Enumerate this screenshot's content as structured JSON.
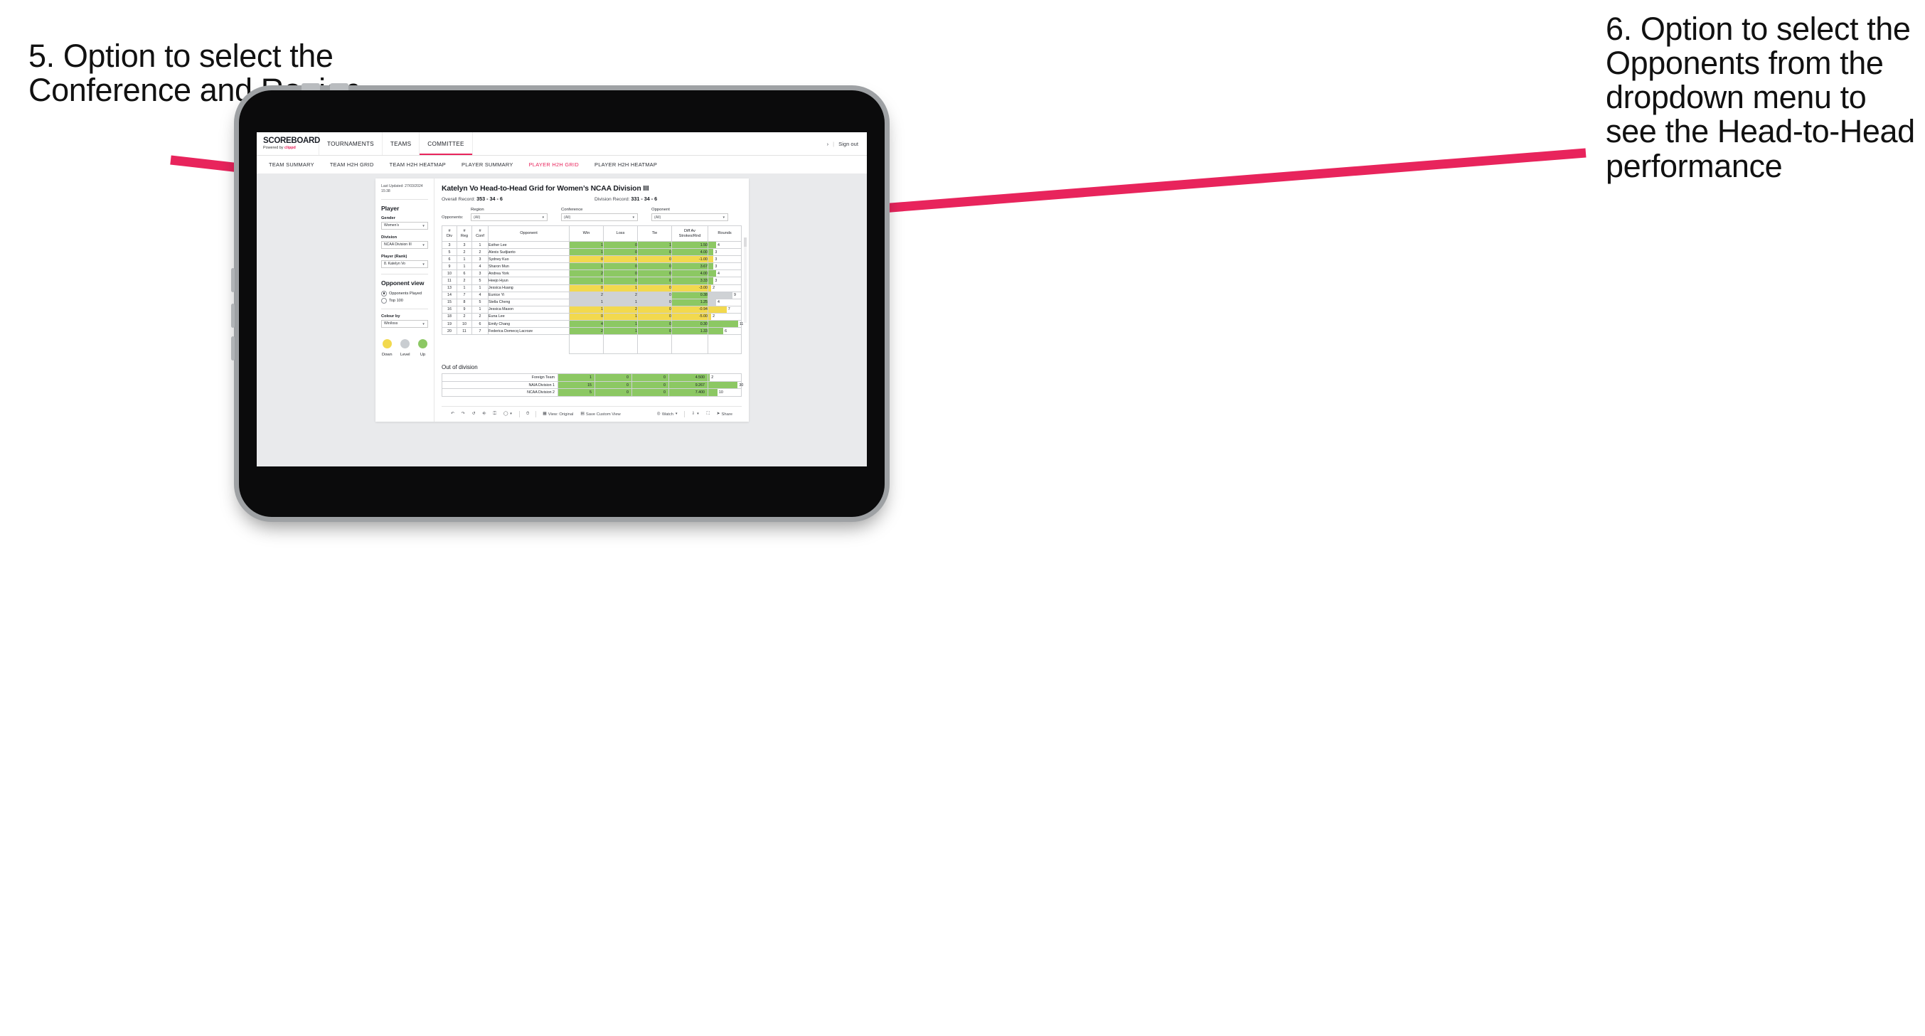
{
  "annotations": {
    "left": "5. Option to select the Conference and Region",
    "right": "6. Option to select the Opponents from the dropdown menu to see the Head-to-Head performance",
    "arrow_color": "#E8245C"
  },
  "topnav": {
    "brand_name": "SCOREBOARD",
    "brand_sub_prefix": "Powered by ",
    "brand_sub_accent": "clippd",
    "tabs": [
      {
        "label": "TOURNAMENTS",
        "active": false
      },
      {
        "label": "TEAMS",
        "active": false
      },
      {
        "label": "COMMITTEE",
        "active": true
      }
    ],
    "chevron": "›",
    "separator": "|",
    "signout": "Sign out"
  },
  "subnav": {
    "tabs": [
      {
        "label": "TEAM SUMMARY",
        "active": false
      },
      {
        "label": "TEAM H2H GRID",
        "active": false
      },
      {
        "label": "TEAM H2H HEATMAP",
        "active": false
      },
      {
        "label": "PLAYER SUMMARY",
        "active": false
      },
      {
        "label": "PLAYER H2H GRID",
        "active": true
      },
      {
        "label": "PLAYER H2H HEATMAP",
        "active": false
      }
    ]
  },
  "sidebar": {
    "last_updated": "Last Updated: 27/03/2024 15:38",
    "section_player": "Player",
    "gender_label": "Gender",
    "gender_value": "Women’s",
    "division_label": "Division",
    "division_value": "NCAA Division III",
    "player_label": "Player (Rank)",
    "player_value": "8. Katelyn Vo",
    "opponent_view_title": "Opponent view",
    "opponent_view_options": [
      {
        "label": "Opponents Played",
        "selected": true
      },
      {
        "label": "Top 100",
        "selected": false
      }
    ],
    "colour_by_label": "Colour by",
    "colour_by_value": "Win/loss",
    "legend": [
      {
        "label": "Down",
        "color": "#F2D94E"
      },
      {
        "label": "Level",
        "color": "#C9CDD1"
      },
      {
        "label": "Up",
        "color": "#8CC863"
      }
    ]
  },
  "content": {
    "title": "Katelyn Vo Head-to-Head Grid for Women’s NCAA Division III",
    "overall_record_label": "Overall Record:",
    "overall_record_value": "353 - 34 - 6",
    "division_record_label": "Division Record:",
    "division_record_value": "331 - 34 - 6",
    "opponents_label": "Opponents:",
    "filters": [
      {
        "label": "Region",
        "value": "(All)"
      },
      {
        "label": "Conference",
        "value": "(All)"
      },
      {
        "label": "Opponent",
        "value": "(All)"
      }
    ]
  },
  "chart_data": {
    "type": "table",
    "title": "Katelyn Vo Head-to-Head Grid for Women’s NCAA Division III",
    "columns": [
      "# Div",
      "# Reg",
      "# Conf",
      "Opponent",
      "Win",
      "Loss",
      "Tie",
      "Diff Av Strokes/Rnd",
      "Rounds"
    ],
    "column_header_lines": [
      [
        "#",
        "Div"
      ],
      [
        "#",
        "Reg"
      ],
      [
        "#",
        "Conf"
      ],
      [
        "Opponent"
      ],
      [
        "Win"
      ],
      [
        "Loss"
      ],
      [
        "Tie"
      ],
      [
        "Diff Av",
        "Strokes/Rnd"
      ],
      [
        "Rounds"
      ]
    ],
    "rows": [
      {
        "div": "3",
        "reg": "3",
        "conf": "1",
        "opponent": "Esther Lee",
        "win": "1",
        "loss": "0",
        "tie": "1",
        "diff": "1.50",
        "rounds": "4",
        "rounds_pct": 24,
        "status": "up"
      },
      {
        "div": "5",
        "reg": "2",
        "conf": "2",
        "opponent": "Alexis Sudjianto",
        "win": "1",
        "loss": "0",
        "tie": "0",
        "diff": "4.00",
        "rounds": "3",
        "rounds_pct": 16,
        "status": "up"
      },
      {
        "div": "6",
        "reg": "1",
        "conf": "3",
        "opponent": "Sydney Kuo",
        "win": "0",
        "loss": "1",
        "tie": "0",
        "diff": "-1.00",
        "rounds": "3",
        "rounds_pct": 16,
        "status": "down"
      },
      {
        "div": "9",
        "reg": "1",
        "conf": "4",
        "opponent": "Sharon Mun",
        "win": "1",
        "loss": "0",
        "tie": "0",
        "diff": "3.67",
        "rounds": "3",
        "rounds_pct": 16,
        "status": "up"
      },
      {
        "div": "10",
        "reg": "6",
        "conf": "3",
        "opponent": "Andrea York",
        "win": "2",
        "loss": "0",
        "tie": "0",
        "diff": "4.00",
        "rounds": "4",
        "rounds_pct": 24,
        "status": "up"
      },
      {
        "div": "11",
        "reg": "2",
        "conf": "5",
        "opponent": "Heejo Hyun",
        "win": "1",
        "loss": "0",
        "tie": "0",
        "diff": "3.33",
        "rounds": "3",
        "rounds_pct": 16,
        "status": "up"
      },
      {
        "div": "13",
        "reg": "1",
        "conf": "1",
        "opponent": "Jessica Huang",
        "win": "0",
        "loss": "1",
        "tie": "0",
        "diff": "-3.00",
        "rounds": "2",
        "rounds_pct": 9,
        "status": "down"
      },
      {
        "div": "14",
        "reg": "7",
        "conf": "4",
        "opponent": "Eunice Yi",
        "win": "2",
        "loss": "2",
        "tie": "0",
        "diff": "0.38",
        "rounds": "9",
        "rounds_pct": 74,
        "status": "level",
        "diff_status": "up"
      },
      {
        "div": "15",
        "reg": "8",
        "conf": "5",
        "opponent": "Stella Cheng",
        "win": "1",
        "loss": "1",
        "tie": "0",
        "diff": "1.25",
        "rounds": "4",
        "rounds_pct": 24,
        "status": "level",
        "diff_status": "up"
      },
      {
        "div": "16",
        "reg": "9",
        "conf": "1",
        "opponent": "Jessica Mason",
        "win": "1",
        "loss": "2",
        "tie": "0",
        "diff": "-0.94",
        "rounds": "7",
        "rounds_pct": 56,
        "status": "down"
      },
      {
        "div": "18",
        "reg": "2",
        "conf": "2",
        "opponent": "Euna Lee",
        "win": "0",
        "loss": "1",
        "tie": "0",
        "diff": "-5.00",
        "rounds": "2",
        "rounds_pct": 9,
        "status": "down"
      },
      {
        "div": "19",
        "reg": "10",
        "conf": "6",
        "opponent": "Emily Chang",
        "win": "4",
        "loss": "1",
        "tie": "0",
        "diff": "0.30",
        "rounds": "11",
        "rounds_pct": 91,
        "status": "up"
      },
      {
        "div": "20",
        "reg": "11",
        "conf": "7",
        "opponent": "Federica Domecq Lacroze",
        "win": "2",
        "loss": "1",
        "tie": "0",
        "diff": "1.33",
        "rounds": "6",
        "rounds_pct": 46,
        "status": "up"
      }
    ],
    "out_of_division_title": "Out of division",
    "out_of_division_rows": [
      {
        "label": "Foreign Team",
        "win": "1",
        "loss": "0",
        "tie": "0",
        "diff": "4.500",
        "rounds": "2",
        "rounds_pct": 5,
        "status": "up"
      },
      {
        "label": "NAIA Division 1",
        "win": "15",
        "loss": "0",
        "tie": "0",
        "diff": "9.267",
        "rounds": "30",
        "rounds_pct": 90,
        "status": "up"
      },
      {
        "label": "NCAA Division 2",
        "win": "5",
        "loss": "0",
        "tie": "0",
        "diff": "7.400",
        "rounds": "10",
        "rounds_pct": 28,
        "status": "up"
      }
    ],
    "colors": {
      "up": "#8CC863",
      "down": "#F2D94E",
      "level": "#CFD2D5",
      "neutral": "#FFFFFF"
    }
  },
  "toolbar": {
    "items": [
      {
        "icon": "undo-icon",
        "label": ""
      },
      {
        "icon": "redo-icon",
        "label": ""
      },
      {
        "icon": "revert-icon",
        "label": ""
      },
      {
        "icon": "refresh-data-icon",
        "label": ""
      },
      {
        "icon": "pause-updates-icon",
        "label": ""
      },
      {
        "icon": "highlight-icon",
        "label": ""
      },
      {
        "icon": "history-icon",
        "label": ""
      },
      {
        "icon": "view-icon",
        "label": "View: Original"
      },
      {
        "icon": "save-view-icon",
        "label": "Save Custom View"
      },
      {
        "icon": "watch-icon",
        "label": "Watch"
      },
      {
        "icon": "download-icon",
        "label": ""
      },
      {
        "icon": "fullscreen-icon",
        "label": ""
      },
      {
        "icon": "share-icon",
        "label": "Share"
      }
    ]
  }
}
